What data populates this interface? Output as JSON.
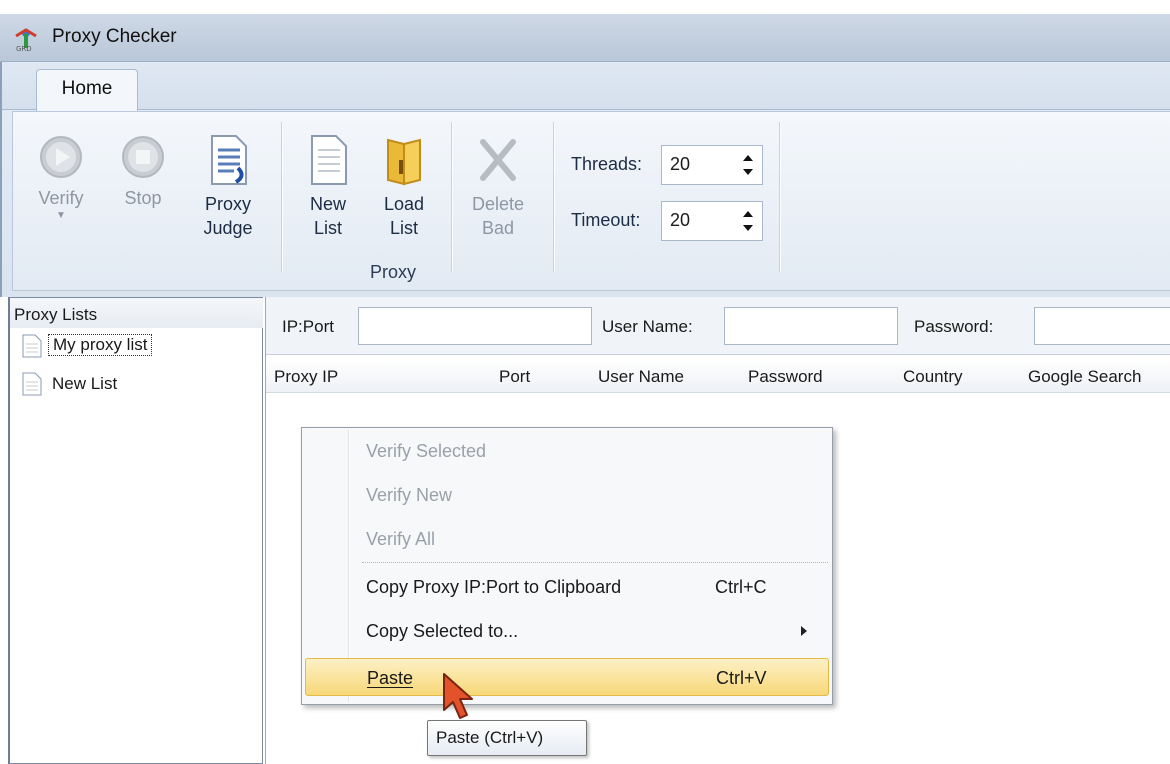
{
  "window": {
    "title": "Proxy Checker"
  },
  "ribbon": {
    "tabs": [
      {
        "label": "Home",
        "active": true
      }
    ],
    "buttons": {
      "verify": {
        "label1": "Verify",
        "enabled": false
      },
      "stop": {
        "label1": "Stop",
        "enabled": false
      },
      "proxy_judge": {
        "label1": "Proxy",
        "label2": "Judge",
        "enabled": true
      },
      "new_list": {
        "label1": "New",
        "label2": "List",
        "enabled": true
      },
      "load_list": {
        "label1": "Load",
        "label2": "List",
        "enabled": true
      },
      "delete_bad": {
        "label1": "Delete",
        "label2": "Bad",
        "enabled": false
      }
    },
    "group_label": "Proxy",
    "threads": {
      "label": "Threads:",
      "value": "20"
    },
    "timeout": {
      "label": "Timeout:",
      "value": "20"
    }
  },
  "sidebar": {
    "header": "Proxy Lists",
    "items": [
      {
        "label": "My proxy list",
        "selected": true
      },
      {
        "label": "New List",
        "selected": false
      }
    ]
  },
  "filters": {
    "ip_port_label": "IP:Port",
    "ip_port_value": "",
    "username_label": "User Name:",
    "username_value": "",
    "password_label": "Password:",
    "password_value": ""
  },
  "grid": {
    "columns": [
      "Proxy IP",
      "Port",
      "User Name",
      "Password",
      "Country",
      "Google Search"
    ],
    "rows": []
  },
  "context_menu": {
    "items": [
      {
        "label": "Verify Selected",
        "enabled": false
      },
      {
        "label": "Verify New",
        "enabled": false
      },
      {
        "label": "Verify All",
        "enabled": false
      },
      {
        "label": "Copy Proxy IP:Port to Clipboard",
        "shortcut": "Ctrl+C",
        "enabled": true
      },
      {
        "label": "Copy Selected to...",
        "submenu": true,
        "enabled": true
      },
      {
        "label": "Paste",
        "shortcut": "Ctrl+V",
        "enabled": true,
        "highlighted": true
      }
    ]
  },
  "tooltip": {
    "text": "Paste (Ctrl+V)"
  },
  "colors": {
    "highlight": "#f7d878",
    "ribbon": "#dfe8f3",
    "disabled_text": "#9aa1ab"
  }
}
